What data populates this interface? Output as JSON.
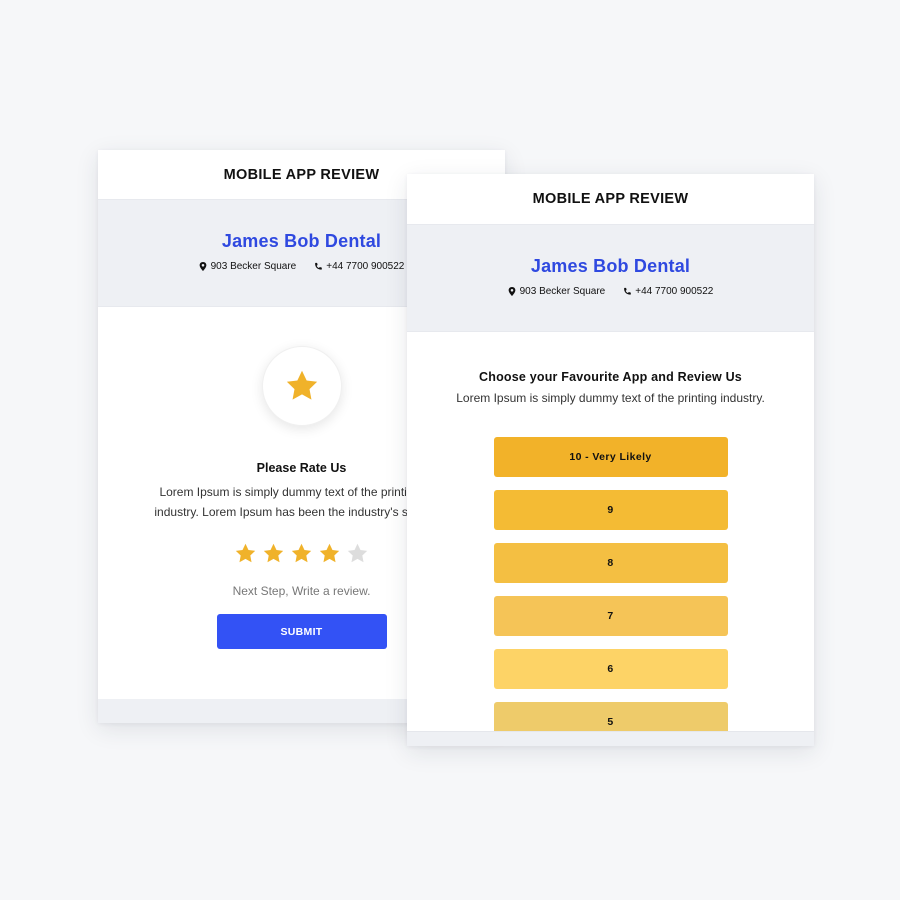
{
  "colors": {
    "accent_blue": "#2f49e0",
    "submit_blue": "#3352f5",
    "star_gold": "#f0b22a",
    "star_empty": "#dddddd"
  },
  "back_card": {
    "header": "MOBILE APP REVIEW",
    "business": {
      "name": "James Bob Dental",
      "address": "903 Becker Square",
      "phone": "+44 7700 900522",
      "address_icon": "map-pin-icon",
      "phone_icon": "phone-icon"
    },
    "badge_icon": "star-icon",
    "rate_title": "Please Rate Us",
    "rate_desc_line1": "Lorem Ipsum is simply dummy text of the printing and",
    "rate_desc_line2": "industry. Lorem Ipsum has been the industry's standard",
    "rating": {
      "value": 4,
      "max": 5
    },
    "next_step": "Next Step, Write a review.",
    "submit_label": "SUBMIT"
  },
  "front_card": {
    "header": "MOBILE APP REVIEW",
    "business": {
      "name": "James Bob Dental",
      "address": "903 Becker Square",
      "phone": "+44 7700 900522",
      "address_icon": "map-pin-icon",
      "phone_icon": "phone-icon"
    },
    "choose_title": "Choose your Favourite App and Review Us",
    "choose_desc": "Lorem Ipsum is simply dummy text of the printing industry.",
    "options": [
      {
        "label": "10 - Very Likely",
        "color": "#f2b229"
      },
      {
        "label": "9",
        "color": "#f4bb34"
      },
      {
        "label": "8",
        "color": "#f4bf42"
      },
      {
        "label": "7",
        "color": "#f5c457"
      },
      {
        "label": "6",
        "color": "#fdd366"
      },
      {
        "label": "5",
        "color": "#eecb6a"
      }
    ]
  }
}
